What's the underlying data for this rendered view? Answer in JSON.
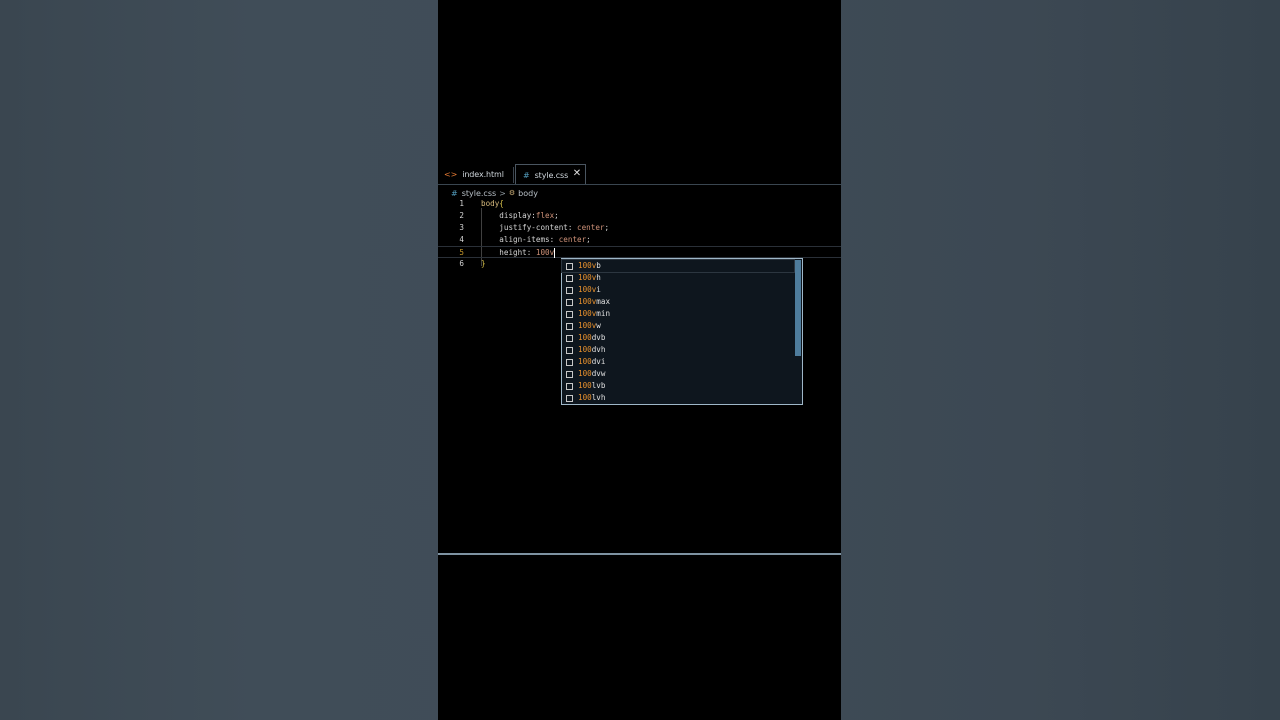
{
  "tabs": [
    {
      "label": "index.html",
      "icon": "html-file-icon"
    },
    {
      "label": "style.css",
      "icon": "css-file-icon",
      "close": "✕"
    }
  ],
  "breadcrumb": {
    "file": "style.css",
    "separator": ">",
    "symbol": "body"
  },
  "code": {
    "line_numbers": [
      "1",
      "2",
      "3",
      "4",
      "5",
      "6"
    ],
    "line1": {
      "selector": "body",
      "brace": "{"
    },
    "line2": {
      "prop": "display:",
      "value": "flex",
      "end": ";"
    },
    "line3": {
      "prop": "justify-content: ",
      "value": "center",
      "end": ";"
    },
    "line4": {
      "prop": "align-items: ",
      "value": "center",
      "end": ";"
    },
    "line5": {
      "prop": "height: ",
      "value": "100v"
    },
    "line6": {
      "brace": "}"
    }
  },
  "suggestions": [
    {
      "match": "100v",
      "rest": "b"
    },
    {
      "match": "100v",
      "rest": "h"
    },
    {
      "match": "100v",
      "rest": "i"
    },
    {
      "match": "100v",
      "rest": "max"
    },
    {
      "match": "100v",
      "rest": "min"
    },
    {
      "match": "100v",
      "rest": "w"
    },
    {
      "match": "100",
      "rest": "dvb"
    },
    {
      "match": "100",
      "rest": "dvh"
    },
    {
      "match": "100",
      "rest": "dvi"
    },
    {
      "match": "100",
      "rest": "dvw"
    },
    {
      "match": "100",
      "rest": "lvb"
    },
    {
      "match": "100",
      "rest": "lvh"
    }
  ],
  "colors": {
    "match": "#e8912d",
    "accent": "#519aba"
  }
}
